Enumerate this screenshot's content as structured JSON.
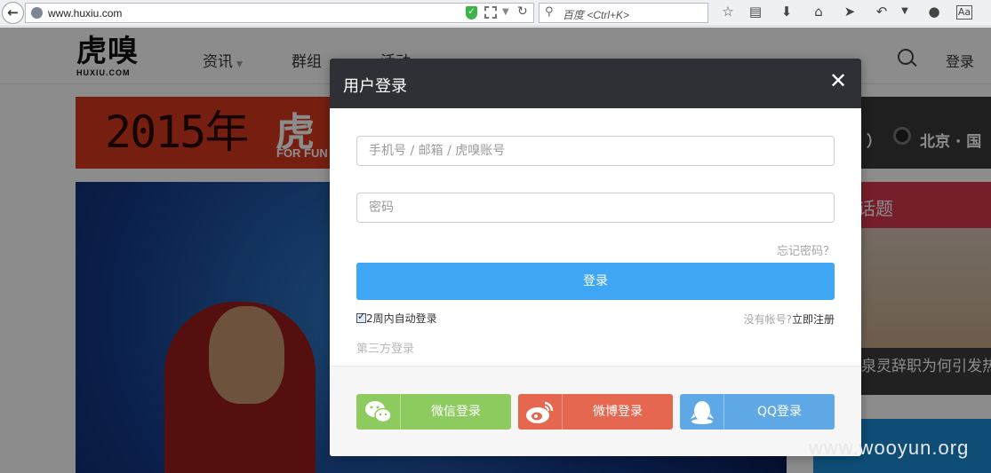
{
  "browser": {
    "url": "www.huxiu.com",
    "search_placeholder": "百度 <Ctrl+K>"
  },
  "site": {
    "logo_main": "虎嗅",
    "logo_sub": "HUXIU.COM",
    "nav": [
      {
        "label": "资讯"
      },
      {
        "label": "群组"
      },
      {
        "label": "活动"
      }
    ],
    "login_link": "登录",
    "banner_text": "2015年",
    "banner_sub": "FOR FUN",
    "banner_right_text": "北京 · 国",
    "sidebar_topic": "话题",
    "sidebar_caption": "泉灵辞职为何引发热"
  },
  "modal": {
    "title": "用户登录",
    "close_glyph": "✕",
    "account_placeholder": "手机号 / 邮箱 / 虎嗅账号",
    "password_placeholder": "密码",
    "forgot_password": "忘记密码？",
    "login_button": "登录",
    "remember_me": "2周内自动登录",
    "no_account": "没有帐号?",
    "register_link": "立即注册",
    "third_party_label": "第三方登录",
    "social": [
      {
        "label": "微信登录",
        "color": "#8dcb5e",
        "icon": "wechat-icon"
      },
      {
        "label": "微博登录",
        "color": "#e6674f",
        "icon": "weibo-icon"
      },
      {
        "label": "QQ登录",
        "color": "#5ea8e6",
        "icon": "qq-icon"
      }
    ]
  },
  "watermark": "www.wooyun.org",
  "colors": {
    "modal_header": "#2e3035",
    "primary": "#3fa5f5",
    "banner_red": "#d83a20"
  }
}
